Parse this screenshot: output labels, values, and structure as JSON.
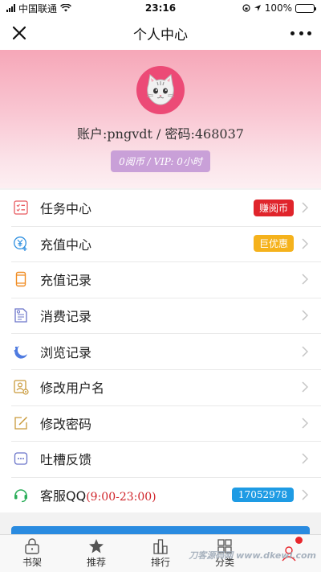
{
  "status_bar": {
    "carrier": "中国联通",
    "time": "23:16",
    "battery": "100%"
  },
  "nav": {
    "title": "个人中心"
  },
  "profile": {
    "account": "账户:pngvdt / 密码:468037",
    "balance": "0阅币 / VIP: 0小时"
  },
  "menu": [
    {
      "label": "任务中心",
      "icon": "task-list-icon",
      "tag": "赚阅币",
      "tag_color": "#e0242b"
    },
    {
      "label": "充值中心",
      "icon": "yuan-coin-icon",
      "tag": "巨优惠",
      "tag_color": "#f5b21c"
    },
    {
      "label": "充值记录",
      "icon": "phone-icon"
    },
    {
      "label": "消费记录",
      "icon": "document-icon"
    },
    {
      "label": "浏览记录",
      "icon": "moon-icon"
    },
    {
      "label": "修改用户名",
      "icon": "user-card-icon"
    },
    {
      "label": "修改密码",
      "icon": "edit-icon"
    },
    {
      "label": "吐槽反馈",
      "icon": "chat-icon"
    },
    {
      "label": "客服QQ",
      "time": "(9:00-23:00)",
      "icon": "headset-icon",
      "tag": "17052978",
      "tag_color": "#1e9be4"
    }
  ],
  "tabs": [
    {
      "label": "书架",
      "icon": "shelf-icon"
    },
    {
      "label": "推荐",
      "icon": "star-icon"
    },
    {
      "label": "排行",
      "icon": "rank-icon"
    },
    {
      "label": "分类",
      "icon": "category-icon"
    },
    {
      "label": "",
      "icon": "user-icon",
      "active": true
    }
  ],
  "watermark": "刀客源码网 www.dkewl.com"
}
